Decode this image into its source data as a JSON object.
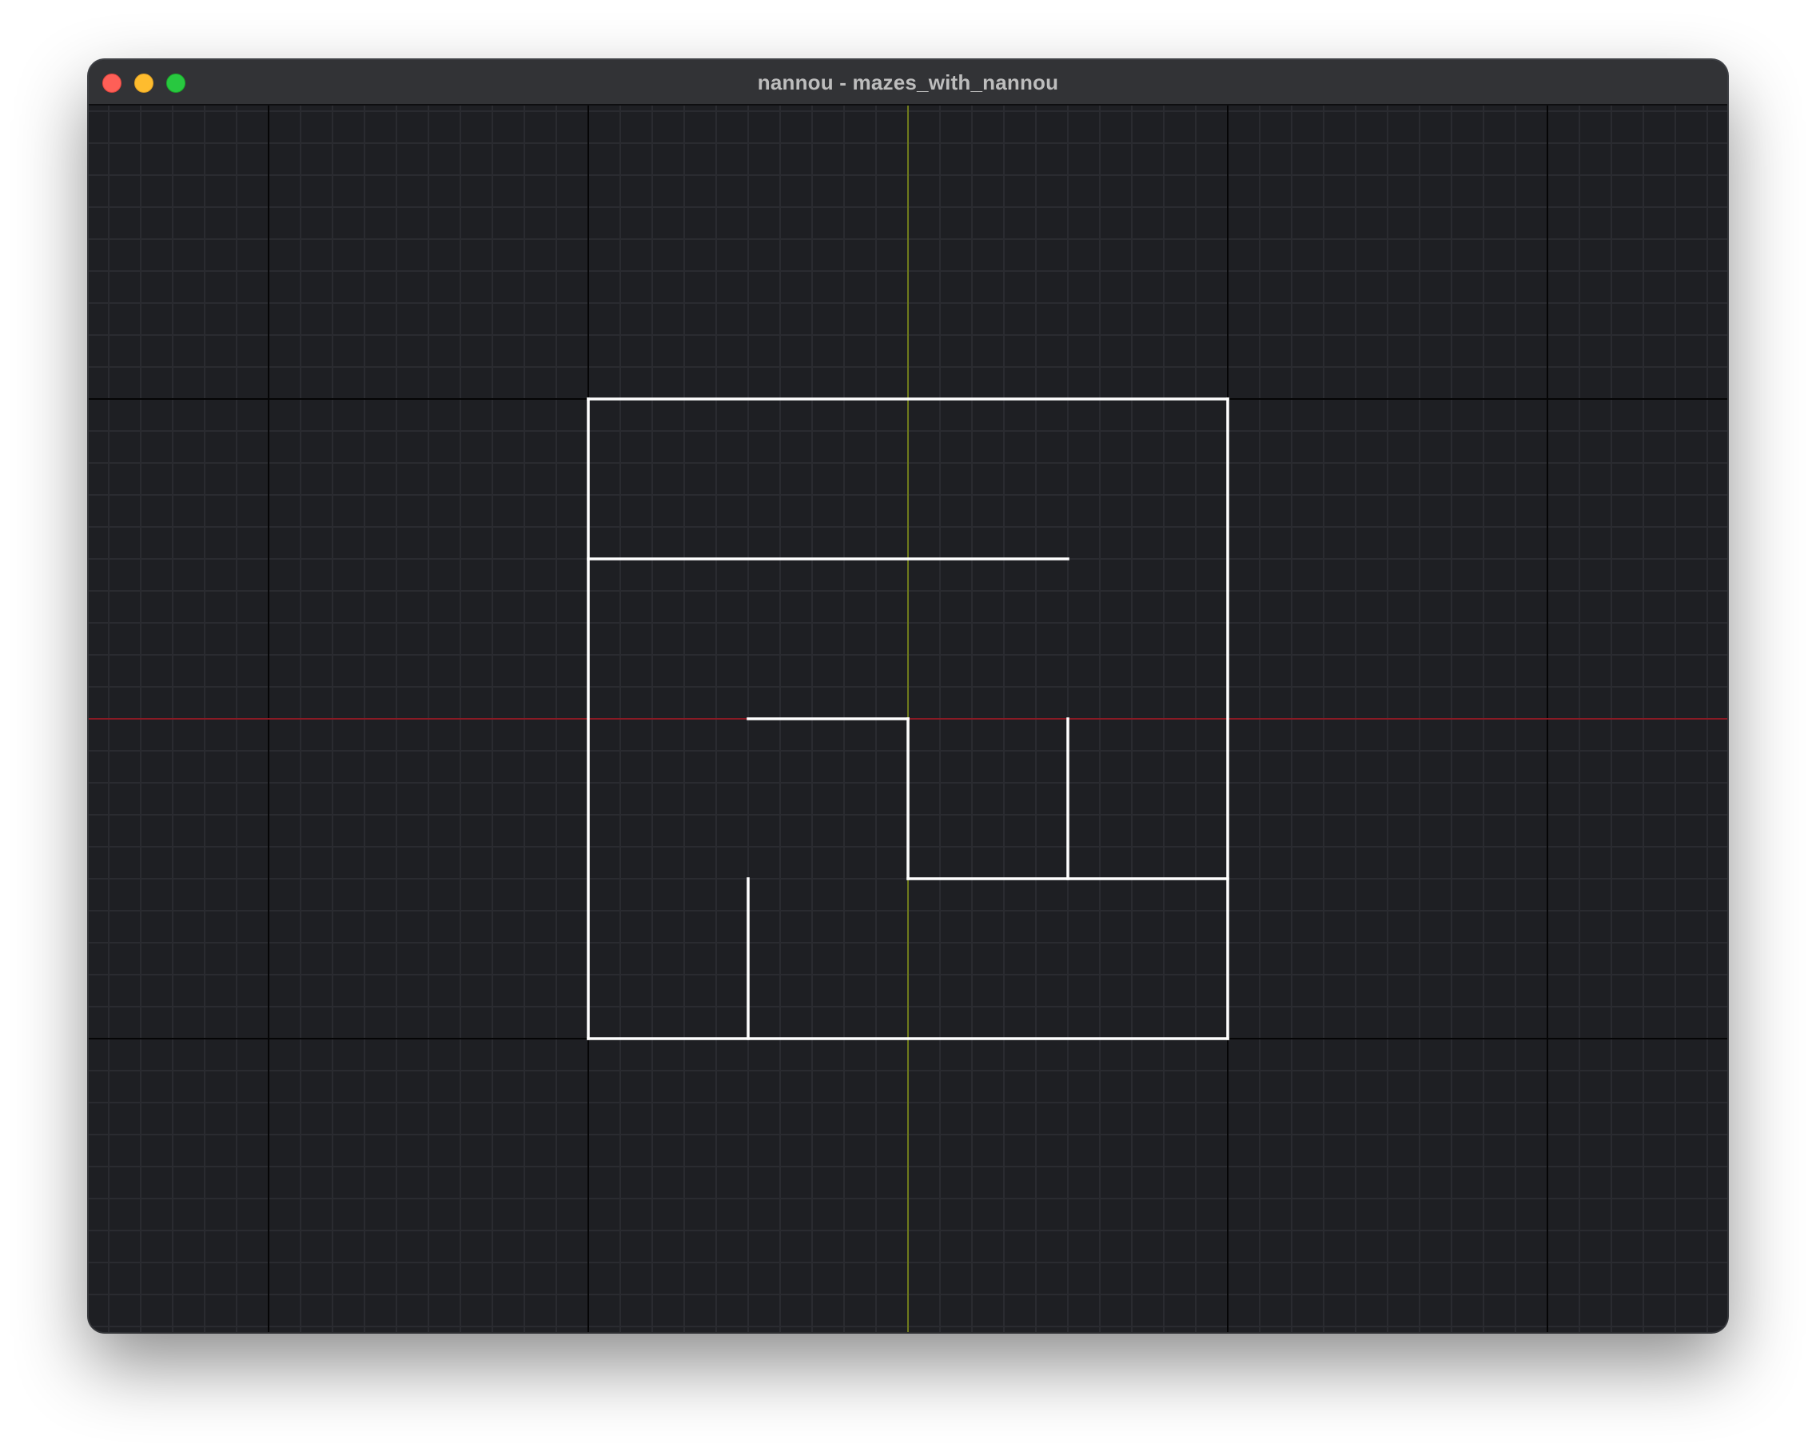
{
  "window": {
    "title": "nannou - mazes_with_nannou"
  },
  "colors": {
    "background": "#1e1f23",
    "grid_minor": "#2a2b30",
    "grid_major": "#050506",
    "x_axis": "#8a1a24",
    "y_axis": "#6f7a1c",
    "maze_wall": "#ffffff"
  },
  "grid": {
    "minor_step": 20,
    "major_step": 200
  },
  "maze": {
    "cell_size": 100,
    "walls": [
      [
        -200,
        200,
        200,
        200
      ],
      [
        -200,
        -200,
        200,
        -200
      ],
      [
        -200,
        200,
        -200,
        -200
      ],
      [
        200,
        200,
        200,
        -200
      ],
      [
        -200,
        100,
        100,
        100
      ],
      [
        -100,
        0,
        0,
        0
      ],
      [
        0,
        0,
        0,
        -100
      ],
      [
        0,
        -100,
        200,
        -100
      ],
      [
        100,
        0,
        100,
        -100
      ],
      [
        -100,
        -100,
        -100,
        -200
      ]
    ]
  }
}
